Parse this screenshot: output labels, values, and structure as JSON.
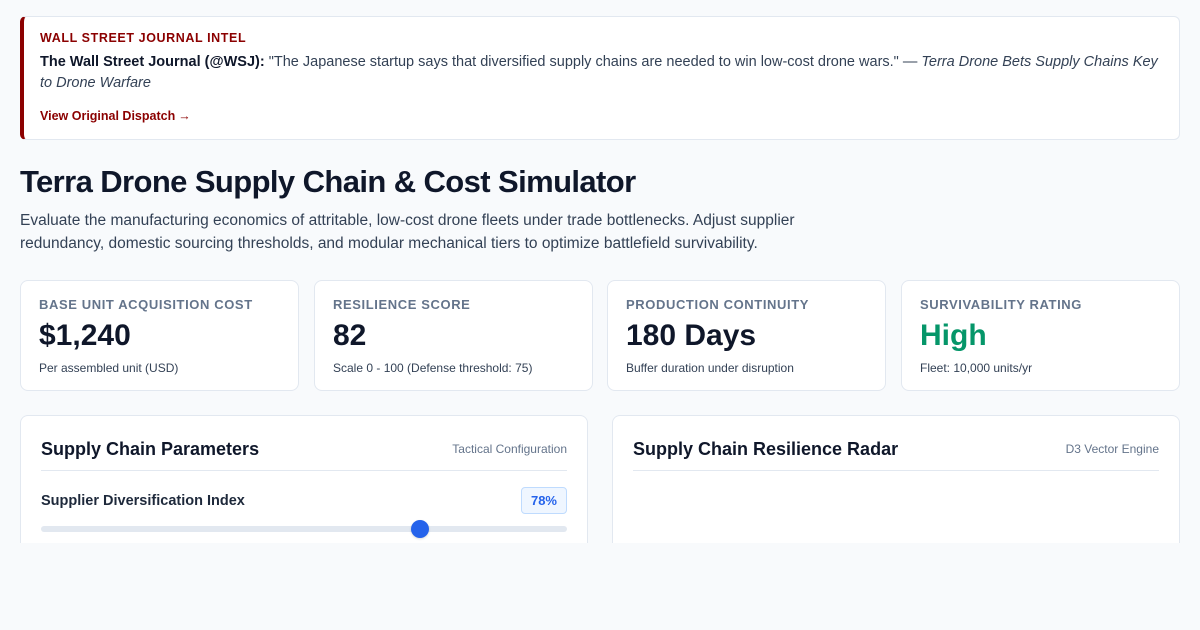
{
  "dispatch": {
    "kicker": "WALL STREET JOURNAL INTEL",
    "source": "The Wall Street Journal (@WSJ):",
    "quote": "\"The Japanese startup says that diversified supply chains are needed to win low-cost drone wars.\" —",
    "headline": "Terra Drone Bets Supply Chains Key to Drone Warfare",
    "link_label": "View Original Dispatch",
    "link_arrow": "→"
  },
  "page": {
    "title": "Terra Drone Supply Chain & Cost Simulator",
    "description": "Evaluate the manufacturing economics of attritable, low-cost drone fleets under trade bottlenecks. Adjust supplier redundancy, domestic sourcing thresholds, and modular mechanical tiers to optimize battlefield survivability."
  },
  "kpis": [
    {
      "label": "BASE UNIT ACQUISITION COST",
      "value": "$1,240",
      "sub": "Per assembled unit (USD)"
    },
    {
      "label": "RESILIENCE SCORE",
      "value": "82",
      "sub": "Scale 0 - 100 (Defense threshold: 75)"
    },
    {
      "label": "PRODUCTION CONTINUITY",
      "value": "180 Days",
      "sub": "Buffer duration under disruption"
    },
    {
      "label": "SURVIVABILITY RATING",
      "value": "High",
      "sub": "Fleet: 10,000 units/yr",
      "value_color": "#059669"
    }
  ],
  "params_panel": {
    "title": "Supply Chain Parameters",
    "tag": "Tactical Configuration",
    "diversification": {
      "label": "Supplier Diversification Index",
      "value_label": "78%",
      "value": 0.72
    }
  },
  "radar_panel": {
    "title": "Supply Chain Resilience Radar",
    "tag": "D3 Vector Engine"
  },
  "colors": {
    "accent": "#2563eb",
    "brand_red": "#8b0000",
    "good": "#059669"
  }
}
